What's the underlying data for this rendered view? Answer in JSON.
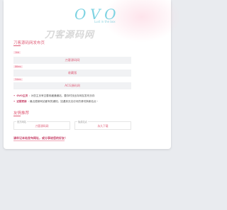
{
  "header": {
    "logo_text": "OVO",
    "logo_sub": "Lust in the box",
    "watermark": "刀客源码网"
  },
  "section_latest": {
    "title": "刀客源码网发布页",
    "links": [
      {
        "tag": "1kb",
        "label": "刀客源码网"
      },
      {
        "tag": "86ms",
        "label": "收藏版"
      },
      {
        "tag": "34ms",
        "label": "ACG源码网"
      }
    ]
  },
  "descriptions": [
    {
      "bullet": "•",
      "name": "OVO主页",
      "text": ": 为您主页有空要收藏通通站，要存时找出存网友发布页存"
    },
    {
      "bullet": "•",
      "name": "近期更新",
      "text": ": 最近更新网站都有的通知，如遇到无法访问的请切换新站点~"
    }
  ],
  "section_recommend": {
    "title": "友情推荐",
    "fields": [
      {
        "label": "官方网站",
        "value": "刀客源码网"
      },
      {
        "label": "免费站点",
        "value": "永久下载"
      }
    ]
  },
  "footer": {
    "notice": "请牢记本站发布网址，或分享给您的好友！"
  },
  "colors": {
    "accent": "#e0607a",
    "logo": "#7ed3e2",
    "background": "#e9ebef"
  }
}
